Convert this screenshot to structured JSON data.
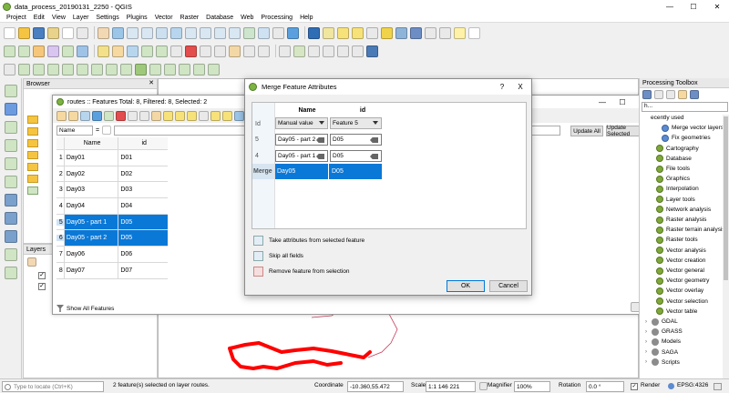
{
  "window": {
    "title": "data_process_20190131_2250 - QGIS"
  },
  "menu": [
    "Project",
    "Edit",
    "View",
    "Layer",
    "Settings",
    "Plugins",
    "Vector",
    "Raster",
    "Database",
    "Web",
    "Processing",
    "Help"
  ],
  "browser": {
    "title": "Browser",
    "items": [
      "",
      "",
      "",
      "",
      "",
      "",
      ""
    ]
  },
  "layers": {
    "title": "Layers"
  },
  "attribute_table": {
    "title": "routes :: Features Total: 8, Filtered: 8, Selected: 2",
    "field_selector": "Name",
    "expression_symbol": "=",
    "update_all": "Update All",
    "update_selected": "Update Selected",
    "columns": [
      "Name",
      "id"
    ],
    "rows": [
      {
        "num": "1",
        "name": "Day01",
        "id": "D01",
        "selected": false
      },
      {
        "num": "2",
        "name": "Day02",
        "id": "D02",
        "selected": false
      },
      {
        "num": "3",
        "name": "Day03",
        "id": "D03",
        "selected": false
      },
      {
        "num": "4",
        "name": "Day04",
        "id": "D04",
        "selected": false
      },
      {
        "num": "5",
        "name": "Day05 - part 1",
        "id": "D05",
        "selected": true
      },
      {
        "num": "6",
        "name": "Day05 - part 2",
        "id": "D05",
        "selected": true
      },
      {
        "num": "7",
        "name": "Day06",
        "id": "D06",
        "selected": false
      },
      {
        "num": "8",
        "name": "Day07",
        "id": "D07",
        "selected": false
      }
    ],
    "show_all": "Show All Features"
  },
  "merge_dialog": {
    "title": "Merge Feature Attributes",
    "help": "?",
    "close": "X",
    "headers": {
      "id": "Id",
      "name": "Name",
      "idcol": "id"
    },
    "strategy": {
      "name": "Manual value",
      "id": "Feature 5"
    },
    "rows": [
      {
        "fid": "5",
        "name": "Day05 - part 2",
        "id": "D05"
      },
      {
        "fid": "4",
        "name": "Day05 - part 1",
        "id": "D05"
      }
    ],
    "merge_row": {
      "label": "Merge",
      "name": "Day05",
      "id": "D05"
    },
    "actions": {
      "take": "Take attributes from selected feature",
      "skip": "Skip all fields",
      "remove": "Remove feature from selection"
    },
    "ok": "OK",
    "cancel": "Cancel"
  },
  "processing": {
    "title": "Processing Toolbox",
    "search": "h...",
    "recent_label": "ecently used",
    "recent": [
      "Merge vector layers",
      "Fix geometries"
    ],
    "groups": [
      "Cartography",
      "Database",
      "File tools",
      "Graphics",
      "Interpolation",
      "Layer tools",
      "Network analysis",
      "Raster analysis",
      "Raster terrain analysis",
      "Raster tools",
      "Vector analysis",
      "Vector creation",
      "Vector general",
      "Vector geometry",
      "Vector overlay",
      "Vector selection",
      "Vector table"
    ],
    "providers": [
      "GDAL",
      "GRASS",
      "Models",
      "SAGA",
      "Scripts"
    ]
  },
  "status": {
    "locate_placeholder": "Type to locate (Ctrl+K)",
    "message": "2 feature(s) selected on layer routes.",
    "coordinate_label": "Coordinate",
    "coordinate": "-10.360,55.472",
    "scale_label": "Scale",
    "scale": "1:1 146 221",
    "magnifier_label": "Magnifier",
    "magnifier": "100%",
    "rotation_label": "Rotation",
    "rotation": "0.0 °",
    "render_label": "Render",
    "crs": "EPSG:4326"
  },
  "colors": {
    "selection": "#0a78d7",
    "route_highlight": "#ff0000",
    "route_line": "#c83c5a"
  }
}
